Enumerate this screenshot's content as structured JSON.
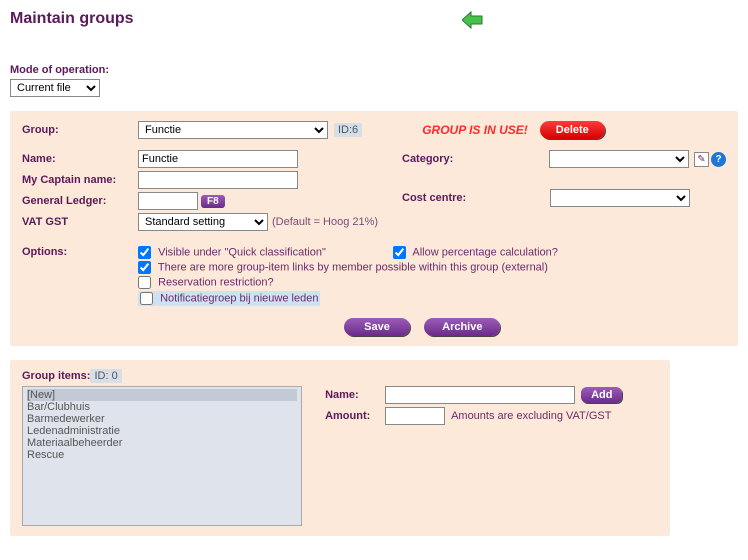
{
  "title": "Maintain groups",
  "modeLabel": "Mode of operation:",
  "modeValue": "Current file",
  "group": {
    "label": "Group:",
    "selected": "Functie",
    "idLabel": "ID:6",
    "inUse": "GROUP IS IN USE!",
    "deleteLabel": "Delete",
    "nameLabel": "Name:",
    "nameValue": "Functie",
    "myCaptainLabel": "My Captain name:",
    "myCaptainValue": "",
    "glLabel": "General Ledger:",
    "glValue": "",
    "f8": "F8",
    "vatLabel": "VAT GST",
    "vatSelected": "Standard setting",
    "vatDefault": "(Default = Hoog 21%)",
    "categoryLabel": "Category:",
    "categoryValue": "",
    "costCentreLabel": "Cost centre:",
    "costCentreValue": "",
    "optionsLabel": "Options:",
    "optVisible": "Visible under \"Quick classification\"",
    "optPercent": "Allow percentage calculation?",
    "optLinks": "There are more group-item links by member possible within this group (external)",
    "optReservation": "Reservation restriction?",
    "optNotification": "Notificatiegroep bij nieuwe leden",
    "saveLabel": "Save",
    "archiveLabel": "Archive"
  },
  "items": {
    "header": "Group items:",
    "idLabel": "ID: 0",
    "list": [
      "[New]",
      "Bar/Clubhuis",
      "Barmedewerker",
      "Ledenadministratie",
      "Materiaalbeheerder",
      "Rescue"
    ],
    "nameLabel": "Name:",
    "nameValue": "",
    "addLabel": "Add",
    "amountLabel": "Amount:",
    "amountValue": "",
    "amountHint": "Amounts are excluding VAT/GST"
  }
}
